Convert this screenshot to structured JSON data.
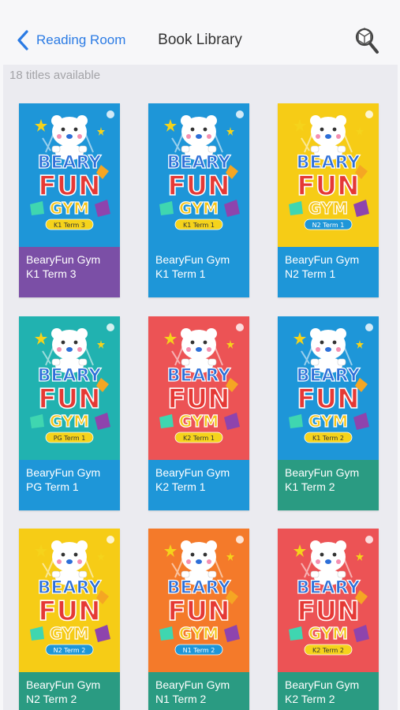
{
  "nav": {
    "back_label": "Reading Room",
    "title": "Book Library"
  },
  "library": {
    "count_text": "18 titles available",
    "books": [
      {
        "title": "BearyFun Gym K1 Term 3",
        "badge": "K1 Term 3",
        "cover_color": "#1e96d8",
        "caption_color": "#7b4fa6",
        "badge_color": "#f5d31b",
        "badge_text_color": "#333333"
      },
      {
        "title": "BearyFun Gym K1 Term 1",
        "badge": "K1 Term 1",
        "cover_color": "#1e96d8",
        "caption_color": "#1e96d8",
        "badge_color": "#f5d31b",
        "badge_text_color": "#333333"
      },
      {
        "title": "BearyFun Gym N2 Term 1",
        "badge": "N2 Term 1",
        "cover_color": "#f6cc16",
        "caption_color": "#1e96d8",
        "badge_color": "#1e96d8",
        "badge_text_color": "#ffffff"
      },
      {
        "title": "BearyFun Gym PG Term 1",
        "badge": "PG Term 1",
        "cover_color": "#21b2b0",
        "caption_color": "#1e96d8",
        "badge_color": "#f5d31b",
        "badge_text_color": "#333333"
      },
      {
        "title": "BearyFun Gym K2 Term 1",
        "badge": "K2 Term 1",
        "cover_color": "#ec5355",
        "caption_color": "#1e96d8",
        "badge_color": "#f5d31b",
        "badge_text_color": "#333333"
      },
      {
        "title": "BearyFun Gym K1 Term 2",
        "badge": "K1 Term 2",
        "cover_color": "#1e96d8",
        "caption_color": "#2a9b82",
        "badge_color": "#f5d31b",
        "badge_text_color": "#333333"
      },
      {
        "title": "BearyFun Gym N2 Term 2",
        "badge": "N2 Term 2",
        "cover_color": "#f6cc16",
        "caption_color": "#2a9b82",
        "badge_color": "#1e96d8",
        "badge_text_color": "#ffffff"
      },
      {
        "title": "BearyFun Gym N1 Term 2",
        "badge": "N1 Term 2",
        "cover_color": "#f47a2a",
        "caption_color": "#2a9b82",
        "badge_color": "#1e96d8",
        "badge_text_color": "#ffffff"
      },
      {
        "title": "BearyFun Gym K2 Term 2",
        "badge": "K2 Term 2",
        "cover_color": "#ec5355",
        "caption_color": "#2a9b82",
        "badge_color": "#f5d31b",
        "badge_text_color": "#333333"
      }
    ]
  },
  "cover_art": {
    "logo_words": [
      "BEARY",
      "FUN",
      "GYM"
    ],
    "logo_colors": [
      "#2d6fd8",
      "#e53935",
      "#f5c518"
    ]
  },
  "icons": {
    "back": "chevron-left-icon",
    "search": "magnifier-cube-icon"
  },
  "theme": {
    "accent": "#2b7be4",
    "background": "#ebebf0"
  }
}
